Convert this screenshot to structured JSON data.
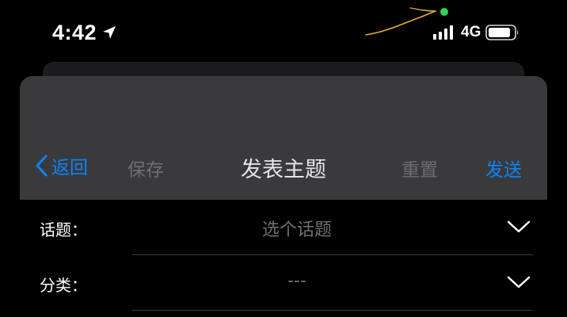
{
  "status_bar": {
    "time": "4:42",
    "network": "4G",
    "icons": [
      "location-arrow-icon",
      "cellular-signal-icon",
      "battery-icon"
    ],
    "privacy_indicator_color": "#30d158"
  },
  "nav": {
    "back_label": "返回",
    "save_label": "保存",
    "title": "发表主题",
    "reset_label": "重置",
    "send_label": "发送",
    "accent_color": "#0a84ff",
    "disabled_color": "#6e6e73"
  },
  "form": {
    "topic": {
      "label": "话题：",
      "value": "选个话题"
    },
    "category": {
      "label": "分类：",
      "value": "---"
    }
  }
}
